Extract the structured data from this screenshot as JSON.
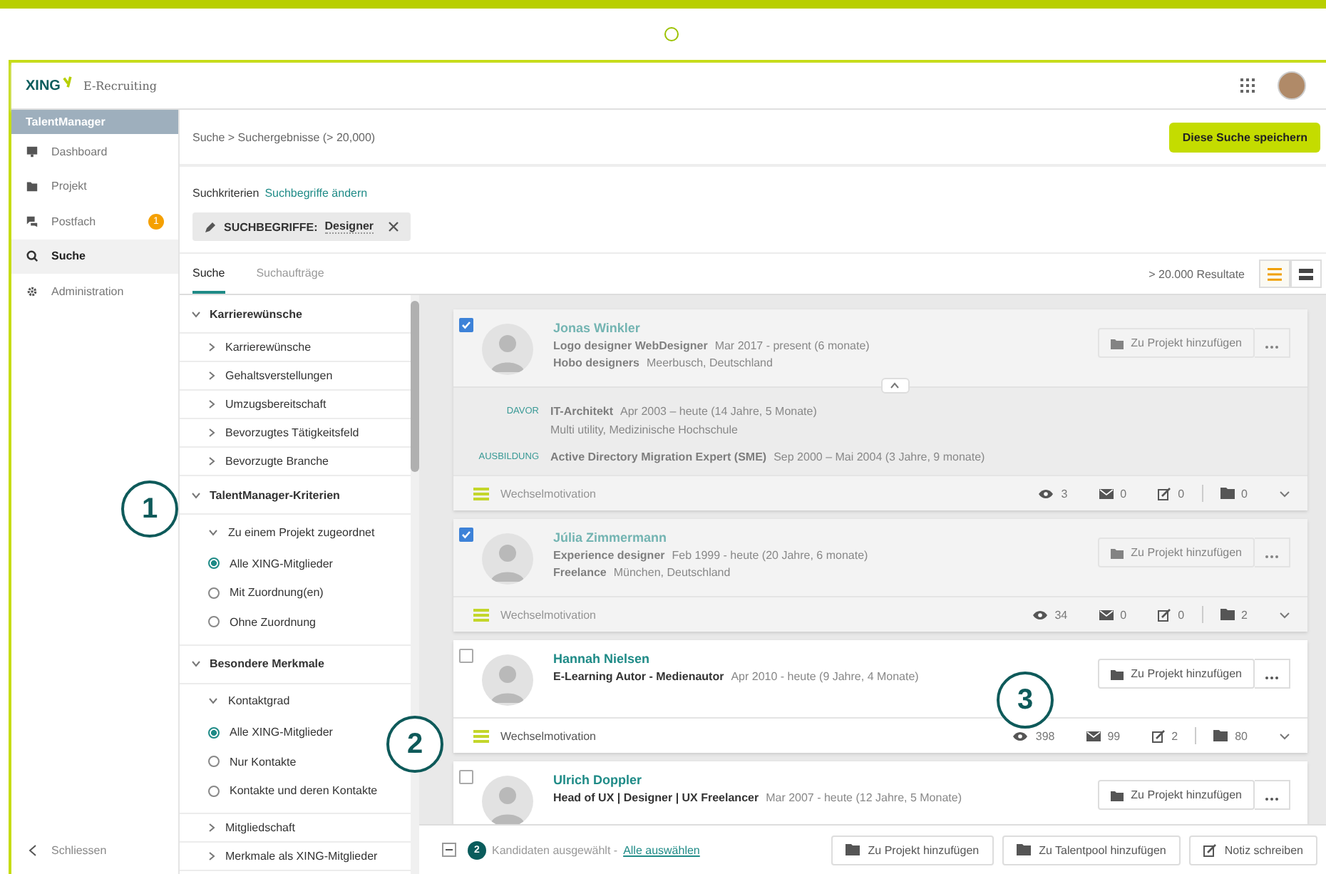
{
  "header": {
    "logo": "XING",
    "product": "E-Recruiting"
  },
  "sidebar": {
    "title": "TalentManager",
    "items": [
      {
        "label": "Dashboard",
        "selected": false
      },
      {
        "label": "Projekt",
        "selected": false
      },
      {
        "label": "Postfach",
        "badge": "1",
        "selected": false
      },
      {
        "label": "Suche",
        "selected": true
      },
      {
        "label": "Administration",
        "selected": false
      }
    ],
    "close": "Schliessen"
  },
  "breadcrumb": "Suche > Suchergebnisse (> 20,000)",
  "save_button": "Diese Suche speichern",
  "criteria": {
    "label": "Suchkriterien",
    "link": "Suchbegriffe ändern",
    "chip_key": "SUCHBEGRIFFE:",
    "chip_value": "Designer"
  },
  "tabs": [
    {
      "label": "Suche",
      "selected": true
    },
    {
      "label": "Suchaufträge",
      "selected": false
    }
  ],
  "result_count": "> 20.000 Resultate",
  "view_toggle": [
    {
      "selected": true
    },
    {
      "selected": false
    }
  ],
  "filters": [
    {
      "title": "Karrierewünsche",
      "items": [
        {
          "kind": "link",
          "label": "Karrierewünsche"
        },
        {
          "kind": "link",
          "label": "Gehaltsverstellungen"
        },
        {
          "kind": "link",
          "label": "Umzugsbereitschaft"
        },
        {
          "kind": "link",
          "label": "Bevorzugtes Tätigkeitsfeld"
        },
        {
          "kind": "link",
          "label": "Bevorzugte Branche"
        }
      ]
    },
    {
      "title": "TalentManager-Kriterien",
      "items": [
        {
          "kind": "group",
          "label": "Zu einem Projekt zugeordnet"
        },
        {
          "kind": "radio",
          "label": "Alle XING-Mitglieder",
          "selected": true
        },
        {
          "kind": "radio",
          "label": "Mit Zuordnung(en)",
          "selected": false
        },
        {
          "kind": "radio",
          "label": "Ohne Zuordnung",
          "selected": false
        }
      ]
    },
    {
      "title": "Besondere Merkmale",
      "items": [
        {
          "kind": "group",
          "label": "Kontaktgrad"
        },
        {
          "kind": "radio",
          "label": "Alle XING-Mitglieder",
          "selected": true
        },
        {
          "kind": "radio",
          "label": "Nur Kontakte",
          "selected": false
        },
        {
          "kind": "radio",
          "label": "Kontakte und deren Kontakte",
          "selected": false
        },
        {
          "kind": "link",
          "label": "Mitgliedschaft"
        },
        {
          "kind": "link",
          "label": "Merkmale als XING-Mitglieder"
        }
      ]
    }
  ],
  "candidates": [
    {
      "checked": true,
      "name": "Jonas Winkler",
      "headline": "Logo designer WebDesigner",
      "period": "Mar 2017 - present (6 monate)",
      "company": "Hobo designers",
      "location": "Meerbusch, Deutschland",
      "action": "Zu Projekt hinzufügen",
      "expanded": true,
      "details": [
        {
          "label": "DAVOR",
          "title": "IT-Architekt",
          "period": "Apr 2003 – heute (14 Jahre, 5 Monate)",
          "org": "Multi utility, Medizinische Hochschule"
        },
        {
          "label": "AUSBILDUNG",
          "title": "Active Directory Migration Expert (SME)",
          "period": "Sep 2000 – Mai 2004 (3 Jahre, 9 monate)"
        }
      ],
      "motivation": "Wechselmotivation",
      "views": "3",
      "messages": "0",
      "notes": "0",
      "projects": "0"
    },
    {
      "checked": true,
      "name": "Júlia Zimmermann",
      "headline": "Experience designer",
      "period": "Feb 1999 - heute (20 Jahre, 6 monate)",
      "company": "Freelance",
      "location": "München, Deutschland",
      "action": "Zu Projekt hinzufügen",
      "motivation": "Wechselmotivation",
      "views": "34",
      "messages": "0",
      "notes": "0",
      "projects": "2"
    },
    {
      "checked": false,
      "name": "Hannah Nielsen",
      "headline": "E-Learning Autor - Medienautor",
      "period": "Apr 2010 - heute (9 Jahre, 4 Monate)",
      "action": "Zu Projekt hinzufügen",
      "motivation": "Wechselmotivation",
      "views": "398",
      "messages": "99",
      "notes": "2",
      "projects": "80"
    },
    {
      "checked": false,
      "name": "Ulrich Doppler",
      "headline": "Head of UX | Designer | UX Freelancer",
      "period": "Mar 2007 - heute (12 Jahre, 5 Monate)",
      "action": "Zu Projekt hinzufügen"
    }
  ],
  "selection_bar": {
    "indeterminate": true,
    "count": "2",
    "text": "Kandidaten ausgewählt -",
    "link": "Alle auswählen",
    "buttons": [
      "Zu Projekt hinzufügen",
      "Zu Talentpool hinzufügen",
      "Notiz schreiben"
    ]
  },
  "annotations": [
    "1",
    "2",
    "3"
  ]
}
